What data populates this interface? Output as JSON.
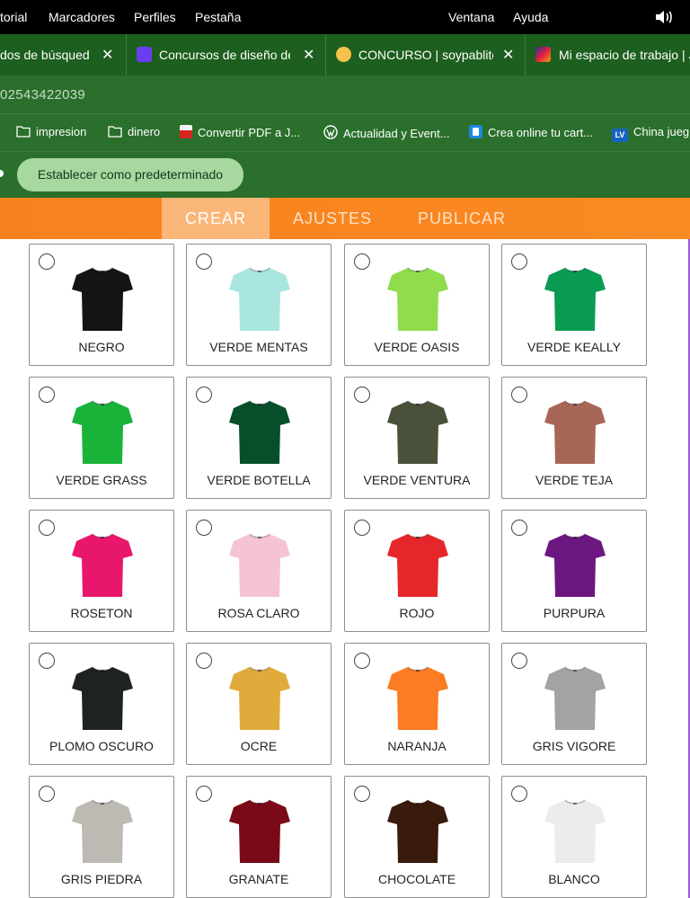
{
  "menubar": {
    "items": [
      "torial",
      "Marcadores",
      "Perfiles",
      "Pestaña",
      "Ventana",
      "Ayuda"
    ]
  },
  "tabs": [
    {
      "title": "dos de búsqueda",
      "close": "✕",
      "icon": "none"
    },
    {
      "title": "Concursos de diseño de",
      "close": "✕",
      "icon": "purple-logo-icon",
      "color": "#6a3df0"
    },
    {
      "title": "CONCURSO | soypablito",
      "close": "✕",
      "icon": "avatar-icon",
      "color": "#f7c24b"
    },
    {
      "title": "Mi espacio de trabajo | J",
      "close": "",
      "icon": "multicolor-logo-icon",
      "color": "#1e3a8a"
    }
  ],
  "url": {
    "text": "02543422039"
  },
  "bookmarks": [
    {
      "label": "impresion",
      "icon": "folder-icon"
    },
    {
      "label": "dinero",
      "icon": "folder-icon"
    },
    {
      "label": "Convertir PDF a J...",
      "icon": "pdf-converter-icon"
    },
    {
      "label": "Actualidad y Event...",
      "icon": "wordpress-icon"
    },
    {
      "label": "Crea online tu cart...",
      "icon": "canvas-icon"
    },
    {
      "label": "China jueg",
      "icon": "lv-icon"
    }
  ],
  "infobar": {
    "default_label": "Establecer como predeterminado"
  },
  "nav": {
    "tabs": [
      "CREAR",
      "AJUSTES",
      "PUBLICAR"
    ],
    "active": 0
  },
  "colors": [
    {
      "name": "NEGRO",
      "hex": "#141414"
    },
    {
      "name": "VERDE MENTAS",
      "hex": "#a9e6e0"
    },
    {
      "name": "VERDE OASIS",
      "hex": "#8fdc4c"
    },
    {
      "name": "VERDE KEALLY",
      "hex": "#0a9b52"
    },
    {
      "name": "VERDE GRASS",
      "hex": "#19b33a"
    },
    {
      "name": "VERDE BOTELLA",
      "hex": "#064f2a"
    },
    {
      "name": "VERDE VENTURA",
      "hex": "#4a513b"
    },
    {
      "name": "VERDE TEJA",
      "hex": "#a86657"
    },
    {
      "name": "ROSETON",
      "hex": "#e8176c"
    },
    {
      "name": "ROSA CLARO",
      "hex": "#f5c2d6"
    },
    {
      "name": "ROJO",
      "hex": "#e5262b"
    },
    {
      "name": "PURPURA",
      "hex": "#6c1680"
    },
    {
      "name": "PLOMO OSCURO",
      "hex": "#1e2320"
    },
    {
      "name": "OCRE",
      "hex": "#e0ab3b"
    },
    {
      "name": "NARANJA",
      "hex": "#fb7c22"
    },
    {
      "name": "GRIS VIGORE",
      "hex": "#a3a3a3"
    },
    {
      "name": "GRIS PIEDRA",
      "hex": "#bdbab3"
    },
    {
      "name": "GRANATE",
      "hex": "#7a0a17"
    },
    {
      "name": "CHOCOLATE",
      "hex": "#3a1a0d"
    },
    {
      "name": "BLANCO",
      "hex": "#ececec"
    }
  ]
}
